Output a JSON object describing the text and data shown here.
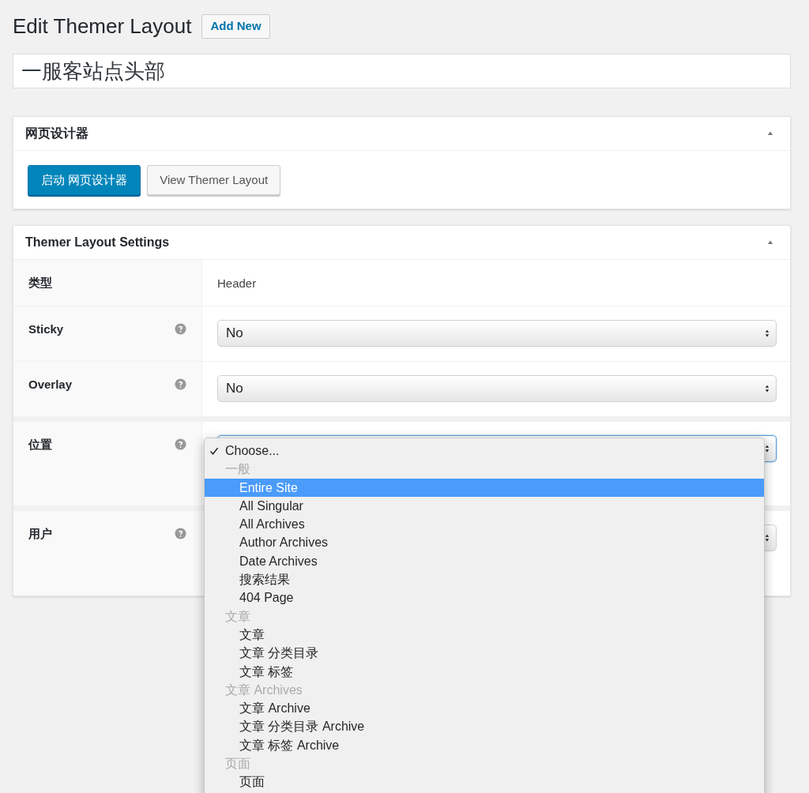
{
  "page": {
    "title": "Edit Themer Layout",
    "add_new": "Add New"
  },
  "post_title": "一服客站点头部",
  "builder_box": {
    "title": "网页设计器",
    "expanded": true,
    "buttons": [
      {
        "label": "启动 网页设计器",
        "kind": "primary"
      },
      {
        "label": "View Themer Layout",
        "kind": "secondary"
      }
    ]
  },
  "settings_box": {
    "title": "Themer Layout Settings",
    "expanded": true,
    "rows": [
      {
        "label": "类型",
        "kind": "text",
        "value": "Header"
      },
      {
        "label": "Sticky",
        "kind": "select",
        "help": true,
        "value": "No"
      },
      {
        "label": "Overlay",
        "kind": "select",
        "help": true,
        "value": "No"
      },
      {
        "label": "位置",
        "kind": "select",
        "help": true,
        "focused": true
      },
      {
        "label": "用户",
        "kind": "select",
        "help": true,
        "focused": false
      }
    ]
  },
  "dropdown": {
    "items": [
      {
        "label": "Choose...",
        "kind": "option",
        "checked": true,
        "selected": false
      },
      {
        "label": "一般",
        "kind": "group"
      },
      {
        "label": "Entire Site",
        "kind": "option",
        "checked": false,
        "selected": true
      },
      {
        "label": "All Singular",
        "kind": "option",
        "checked": false,
        "selected": false
      },
      {
        "label": "All Archives",
        "kind": "option",
        "checked": false,
        "selected": false
      },
      {
        "label": "Author Archives",
        "kind": "option",
        "checked": false,
        "selected": false
      },
      {
        "label": "Date Archives",
        "kind": "option",
        "checked": false,
        "selected": false
      },
      {
        "label": "搜索结果",
        "kind": "option",
        "checked": false,
        "selected": false
      },
      {
        "label": "404 Page",
        "kind": "option",
        "checked": false,
        "selected": false
      },
      {
        "label": "文章",
        "kind": "group"
      },
      {
        "label": "文章",
        "kind": "option",
        "checked": false,
        "selected": false
      },
      {
        "label": "文章 分类目录",
        "kind": "option",
        "checked": false,
        "selected": false
      },
      {
        "label": "文章 标签",
        "kind": "option",
        "checked": false,
        "selected": false
      },
      {
        "label": "文章 Archives",
        "kind": "group"
      },
      {
        "label": "文章 Archive",
        "kind": "option",
        "checked": false,
        "selected": false
      },
      {
        "label": "文章 分类目录 Archive",
        "kind": "option",
        "checked": false,
        "selected": false
      },
      {
        "label": "文章 标签 Archive",
        "kind": "option",
        "checked": false,
        "selected": false
      },
      {
        "label": "页面",
        "kind": "group"
      },
      {
        "label": "页面",
        "kind": "option",
        "checked": false,
        "selected": false
      }
    ]
  }
}
